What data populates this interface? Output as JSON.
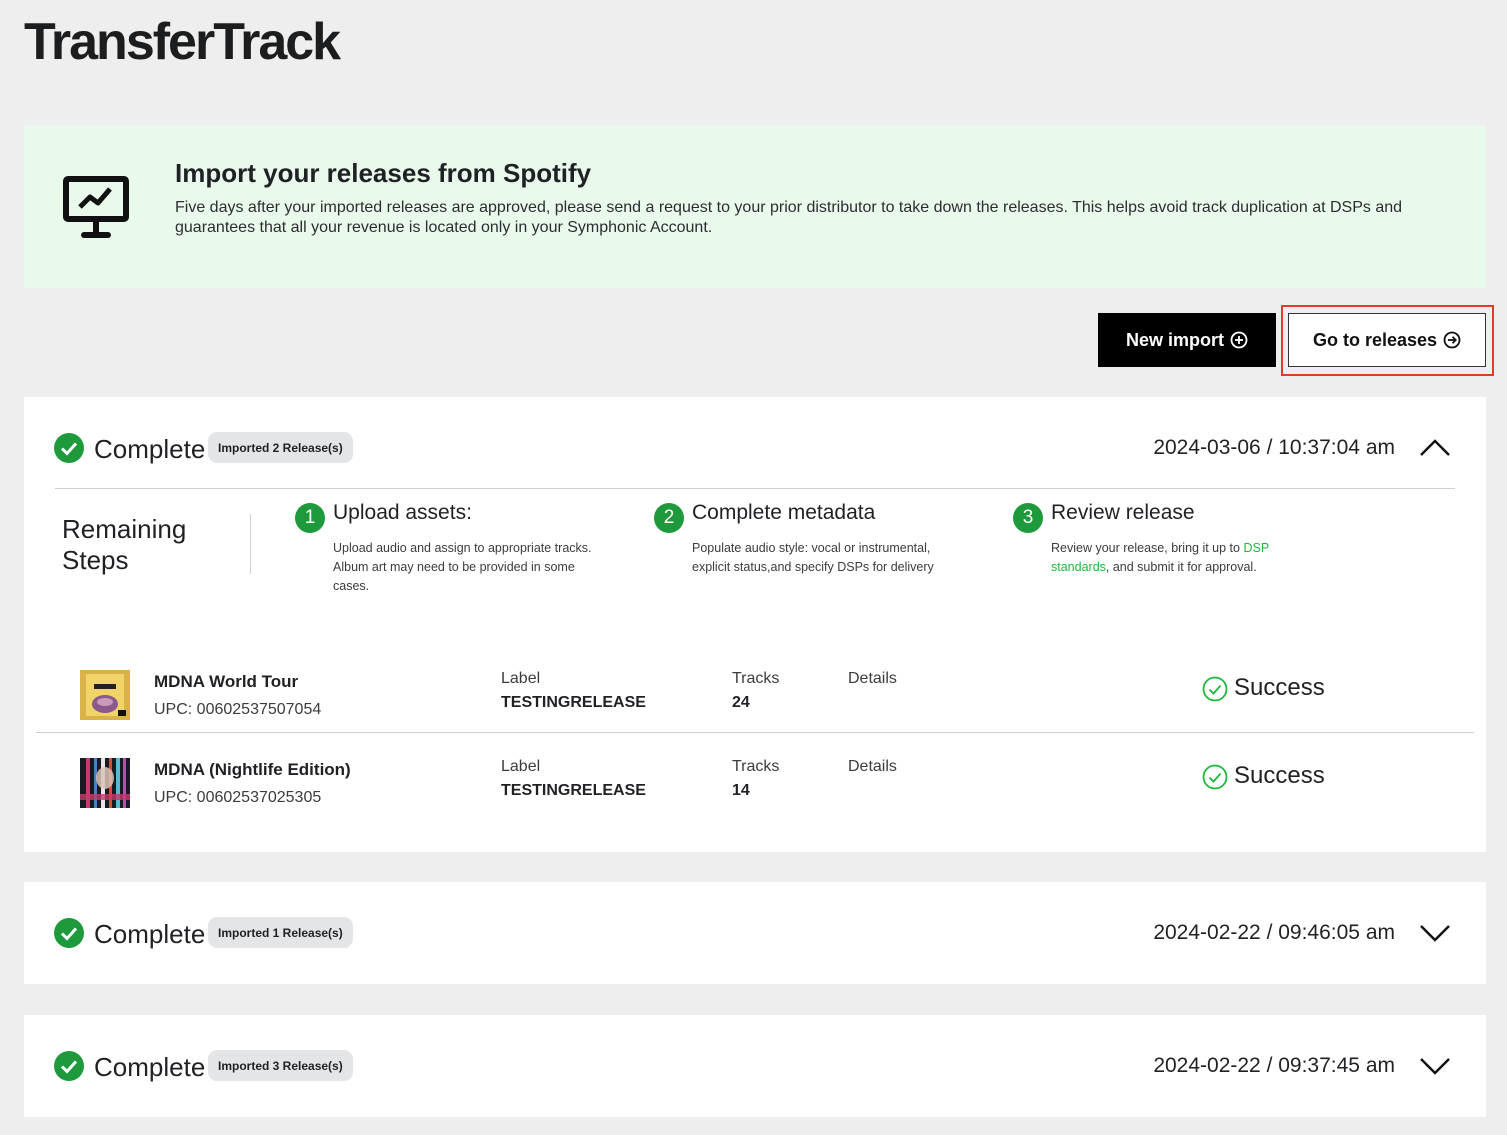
{
  "app": {
    "title": "TransferTrack"
  },
  "banner": {
    "icon": "presentation-chart-icon",
    "heading": "Import your releases from Spotify",
    "text": "Five days after your imported releases are approved, please send a request to your prior distributor to take down the releases. This helps avoid track duplication at DSPs and guarantees that all your revenue is located only in your Symphonic Account."
  },
  "actions": {
    "new_import": "New import",
    "go_to_releases": "Go to releases"
  },
  "imports": [
    {
      "status": "Complete",
      "badge": "Imported 2 Release(s)",
      "timestamp": "2024-03-06 / 10:37:04 am",
      "expanded": true,
      "remaining_steps": {
        "title_line1": "Remaining",
        "title_line2": "Steps",
        "steps": [
          {
            "num": "1",
            "title": "Upload assets:",
            "desc": "Upload audio and assign to appropriate tracks. Album art may need to be provided in some cases."
          },
          {
            "num": "2",
            "title": "Complete metadata",
            "desc": "Populate audio style: vocal or instrumental, explicit status,and specify DSPs for delivery"
          },
          {
            "num": "3",
            "title": "Review release",
            "desc_before": "Review your release, bring it up to ",
            "desc_link": "DSP standards",
            "desc_after": ", and submit it for approval."
          }
        ]
      },
      "releases": [
        {
          "title": "MDNA World Tour",
          "upc": "UPC: 00602537507054",
          "label_header": "Label",
          "label": "TESTINGRELEASE",
          "tracks_header": "Tracks",
          "tracks": "24",
          "details_header": "Details",
          "status": "Success"
        },
        {
          "title": "MDNA (Nightlife Edition)",
          "upc": "UPC: 00602537025305",
          "label_header": "Label",
          "label": "TESTINGRELEASE",
          "tracks_header": "Tracks",
          "tracks": "14",
          "details_header": "Details",
          "status": "Success"
        }
      ]
    },
    {
      "status": "Complete",
      "badge": "Imported 1 Release(s)",
      "timestamp": "2024-02-22 / 09:46:05 am",
      "expanded": false
    },
    {
      "status": "Complete",
      "badge": "Imported 3 Release(s)",
      "timestamp": "2024-02-22 / 09:37:45 am",
      "expanded": false
    }
  ],
  "colors": {
    "accent_green": "#1e9a3c",
    "link_green": "#1eb83d",
    "banner_bg": "#e9f9ec",
    "highlight": "#e43c22"
  }
}
